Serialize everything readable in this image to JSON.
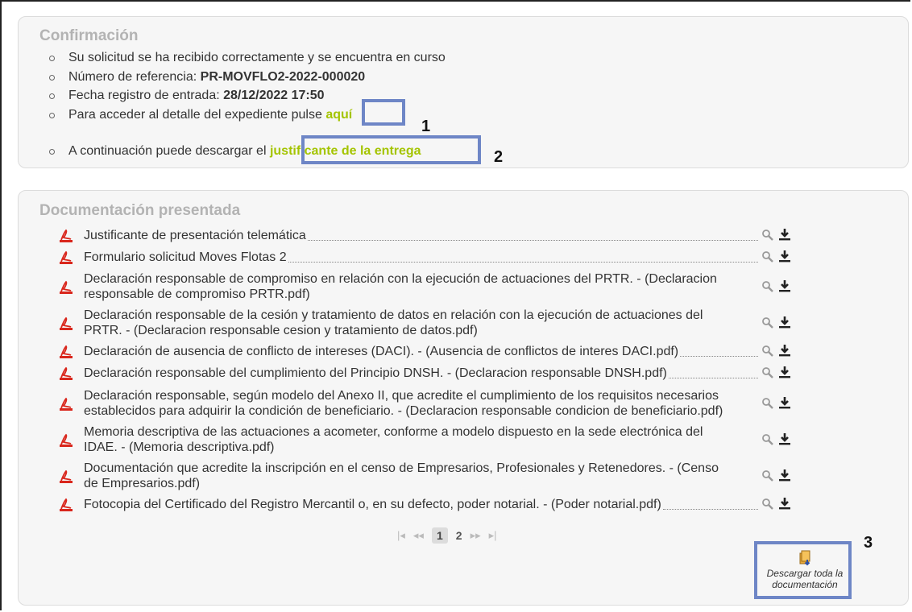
{
  "confirmation": {
    "title": "Confirmación",
    "items": [
      {
        "text": "Su solicitud se ha recibido correctamente y se encuentra en curso"
      },
      {
        "label": "Número de referencia: ",
        "value": "PR-MOVFLO2-2022-000020"
      },
      {
        "label": "Fecha registro de entrada: ",
        "value": "28/12/2022 17:50"
      },
      {
        "label": "Para acceder al detalle del expediente pulse ",
        "link": "aquí"
      },
      {
        "label": "A continuación puede descargar el ",
        "link": "justificante de la entrega"
      }
    ]
  },
  "annotations": {
    "one": "1",
    "two": "2",
    "three": "3",
    "box_color": "#6e86c6"
  },
  "documentation": {
    "title": "Documentación presentada",
    "rows": [
      {
        "lines": [
          "Justificante de presentación telemática"
        ]
      },
      {
        "lines": [
          "Formulario solicitud Moves Flotas 2"
        ]
      },
      {
        "lines": [
          "Declaración responsable de compromiso en relación con la ejecución de actuaciones del PRTR. - (Declaracion",
          "responsable de compromiso PRTR.pdf)"
        ]
      },
      {
        "lines": [
          "Declaración responsable de la cesión y tratamiento de datos en relación con la ejecución de actuaciones del",
          "PRTR. - (Declaracion responsable cesion y tratamiento de datos.pdf)"
        ]
      },
      {
        "lines": [
          "Declaración de ausencia de conflicto de intereses (DACI). - (Ausencia de conflictos de interes DACI.pdf)"
        ]
      },
      {
        "lines": [
          "Declaración responsable del cumplimiento del Principio DNSH. - (Declaracion responsable DNSH.pdf)"
        ]
      },
      {
        "lines": [
          "Declaración responsable, según modelo del Anexo II, que acredite el cumplimiento de los requisitos necesarios",
          "establecidos para adquirir la condición de beneficiario. - (Declaracion responsable condicion de beneficiario.pdf)"
        ]
      },
      {
        "lines": [
          "Memoria descriptiva de las actuaciones a acometer, conforme a modelo dispuesto en la sede electrónica del",
          "IDAE. - (Memoria descriptiva.pdf)"
        ]
      },
      {
        "lines": [
          "Documentación que acredite la inscripción en el censo de Empresarios, Profesionales y Retenedores. - (Censo",
          "de Empresarios.pdf)"
        ]
      },
      {
        "lines": [
          "Fotocopia del Certificado del Registro Mercantil o, en su defecto, poder notarial. - (Poder notarial.pdf)"
        ]
      }
    ],
    "pager": {
      "first": "|◂",
      "prev": "◂◂",
      "pages": [
        "1",
        "2"
      ],
      "current": "1",
      "next": "▸▸",
      "last": "▸|"
    },
    "download_all": {
      "line1": "Descargar toda la",
      "line2": "documentación"
    }
  },
  "colors": {
    "link": "#a4c400",
    "pdf": "#d9261c",
    "title": "#b3b3b3"
  }
}
